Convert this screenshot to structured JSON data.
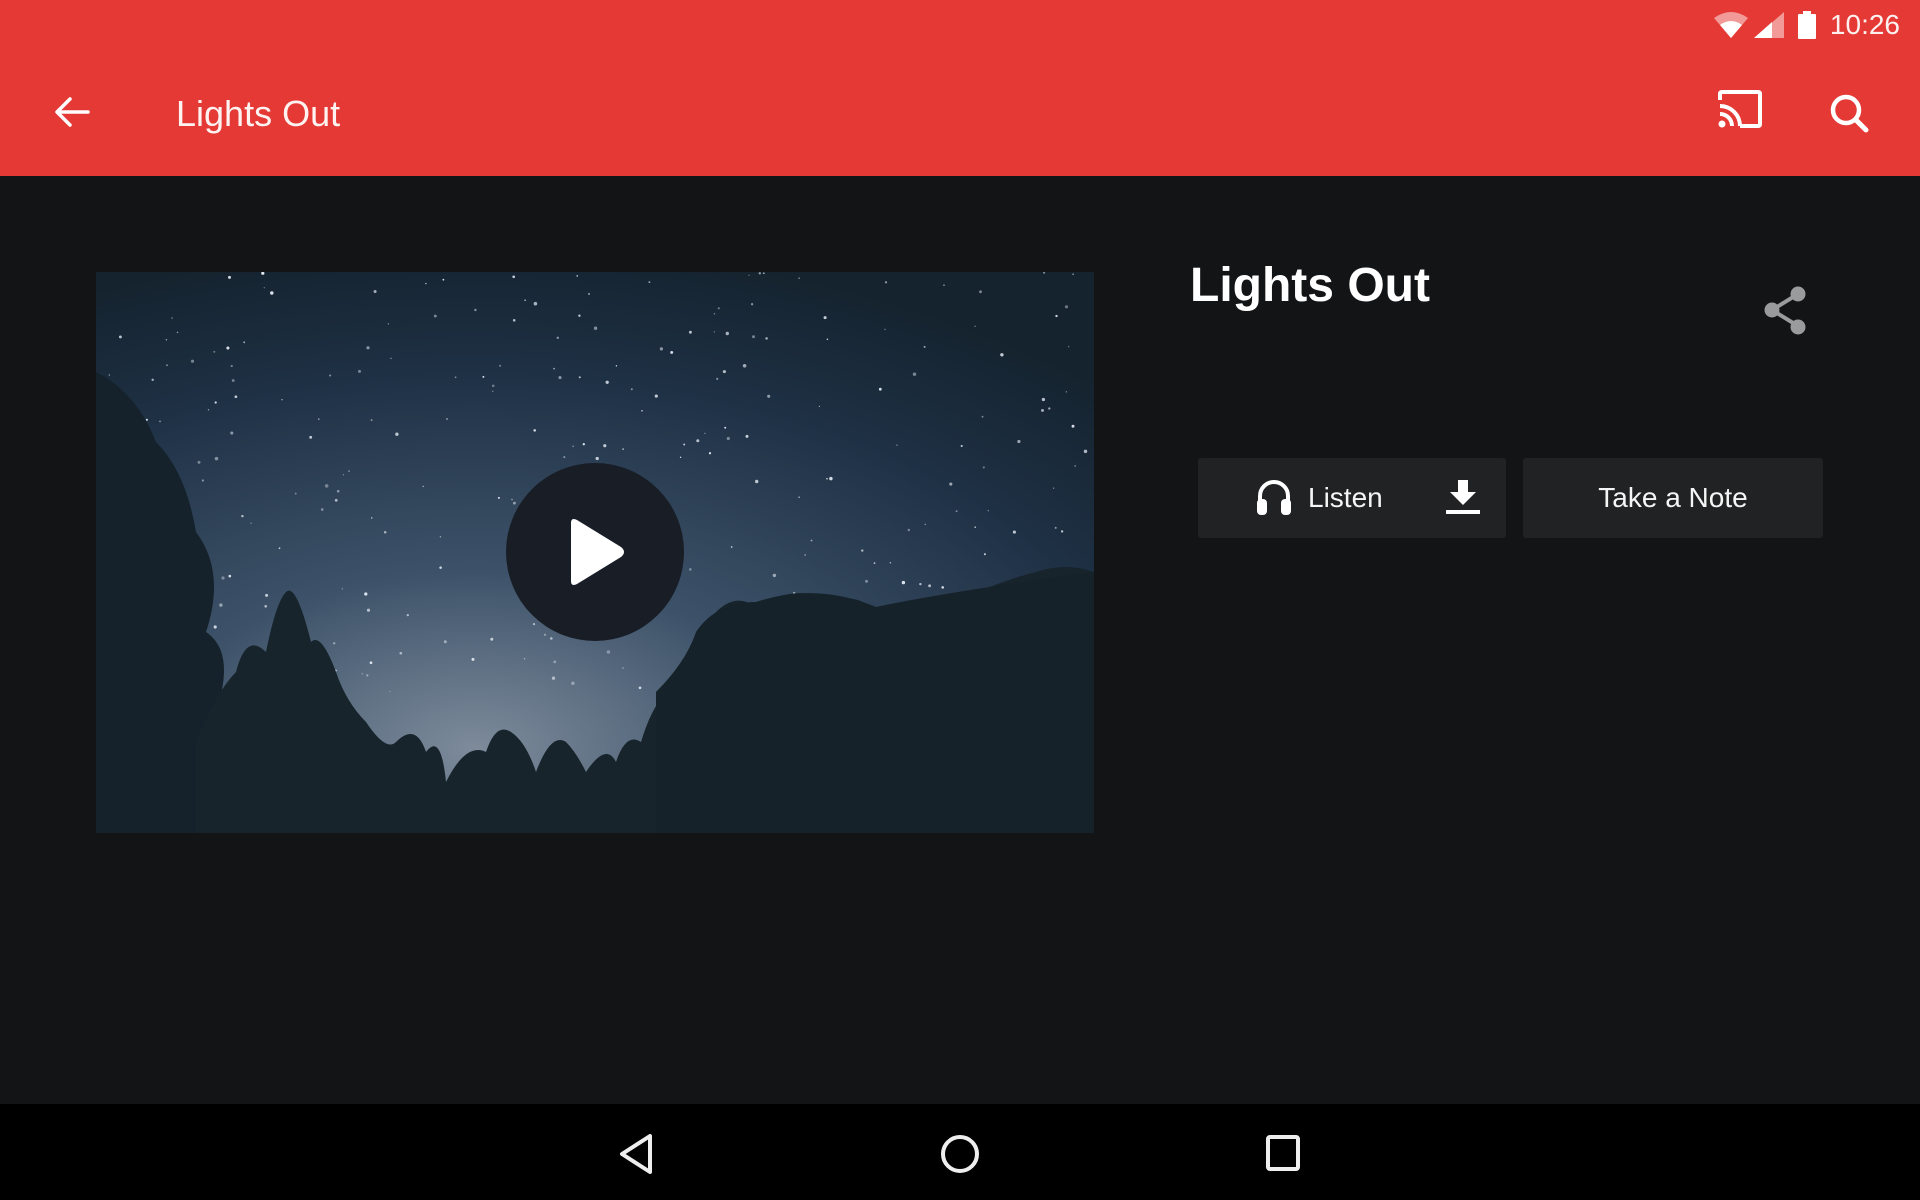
{
  "status_bar": {
    "time": "10:26",
    "icons": [
      "wifi-icon",
      "cell-signal-icon",
      "battery-icon"
    ]
  },
  "toolbar": {
    "title": "Lights Out",
    "back_icon": "arrow-left-icon",
    "actions": [
      "cast-icon",
      "search-icon"
    ]
  },
  "colors": {
    "primary": "#e53935",
    "background": "#131416",
    "button_bg": "#212223",
    "nav_bar": "#000000"
  },
  "video": {
    "thumbnail_description": "Starry night sky over tree silhouettes",
    "play_icon": "play-icon"
  },
  "detail": {
    "title": "Lights Out",
    "share_icon": "share-icon"
  },
  "actions": {
    "listen_label": "Listen",
    "listen_icon": "headphones-icon",
    "download_icon": "download-icon",
    "note_label": "Take a Note"
  },
  "nav_bar": {
    "buttons": [
      "back",
      "home",
      "recents"
    ]
  }
}
